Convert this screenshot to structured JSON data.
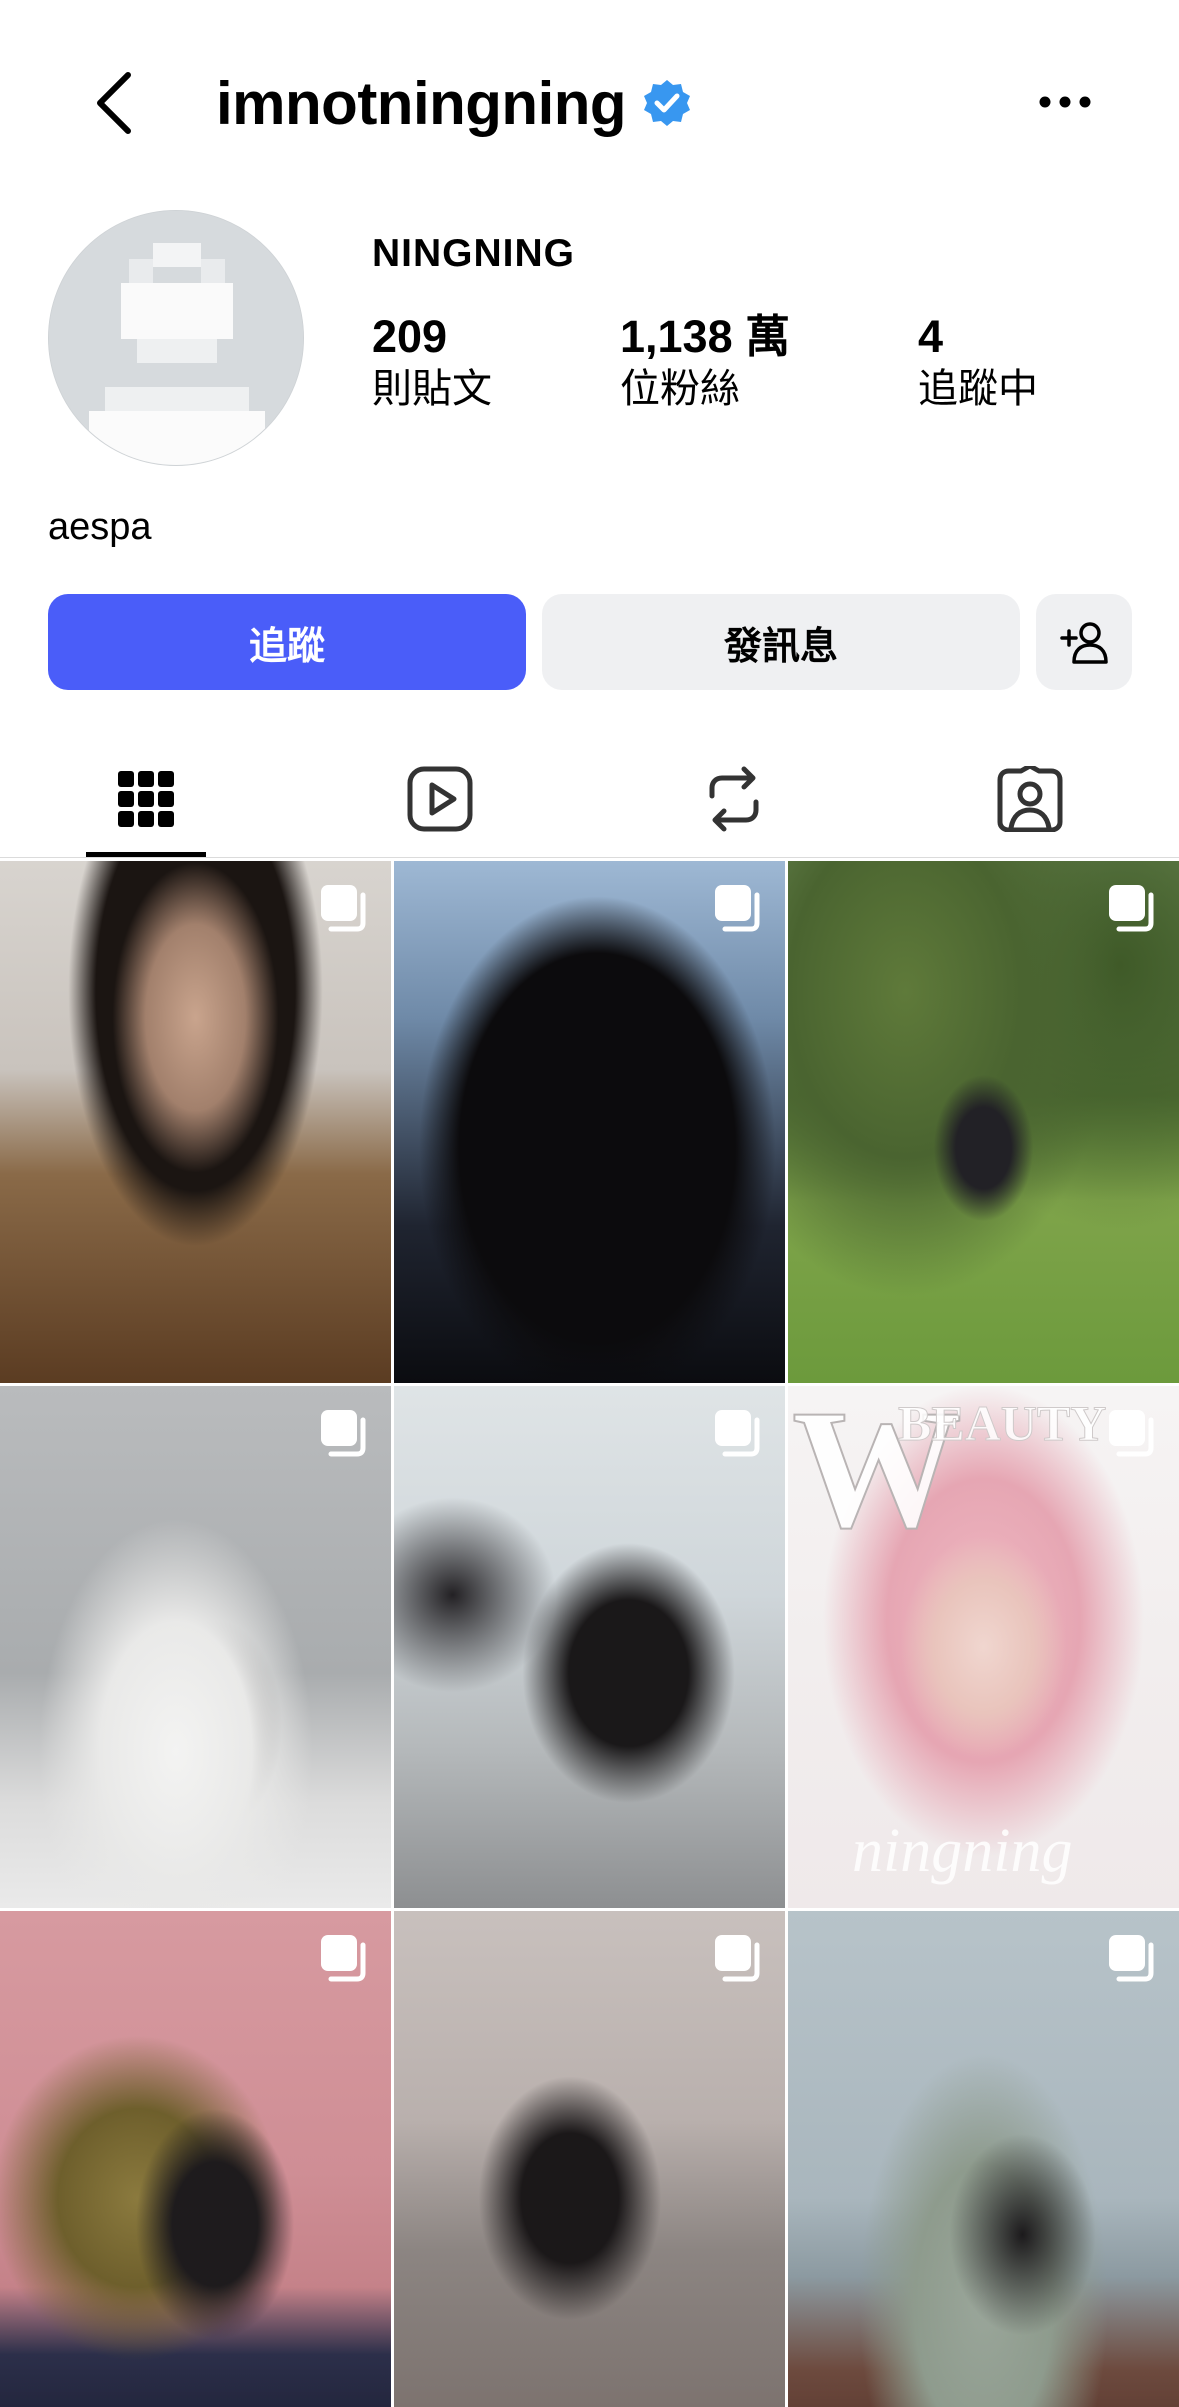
{
  "header": {
    "username": "imnotningning",
    "back_icon": "chevron-left-icon",
    "verified_icon": "verified-badge-icon",
    "more_icon": "more-horizontal-icon"
  },
  "profile": {
    "display_name": "NINGNING",
    "bio": "aespa",
    "stats": {
      "posts": {
        "value": "209",
        "label": "則貼文"
      },
      "followers": {
        "value": "1,138 萬",
        "label": "位粉絲"
      },
      "following": {
        "value": "4",
        "label": "追蹤中"
      }
    }
  },
  "actions": {
    "follow_label": "追蹤",
    "message_label": "發訊息",
    "add_user_icon": "add-user-icon"
  },
  "tabs": [
    {
      "name": "posts",
      "icon": "grid-icon",
      "active": true
    },
    {
      "name": "reels",
      "icon": "reels-icon",
      "active": false
    },
    {
      "name": "reposts",
      "icon": "repost-icon",
      "active": false
    },
    {
      "name": "tagged",
      "icon": "tagged-icon",
      "active": false
    }
  ],
  "grid": {
    "multi_icon": "carousel-icon",
    "watermark_letter": "W",
    "watermark_text": "BEAUTY",
    "watermark_script": "ningning"
  },
  "colors": {
    "accent": "#4a5df9",
    "secondary_button": "#eff0f2",
    "verified": "#3897f0"
  }
}
